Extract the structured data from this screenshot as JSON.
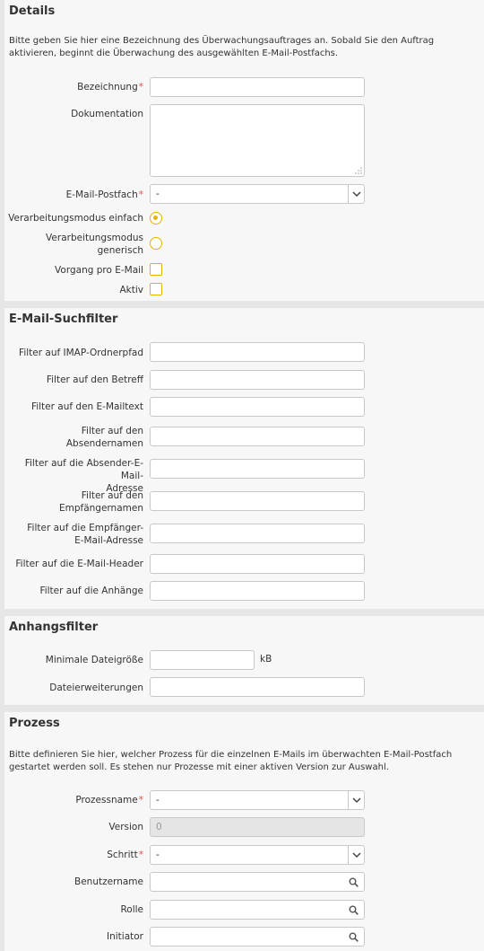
{
  "details": {
    "title": "Details",
    "description": "Bitte geben Sie hier eine Bezeichnung des Überwachungsauftrages an. Sobald Sie den Auftrag aktivieren, beginnt die Überwachung des ausgewählten E-Mail-Postfachs.",
    "bezeichnung_label": "Bezeichnung",
    "bezeichnung_value": "",
    "dokumentation_label": "Dokumentation",
    "dokumentation_value": "",
    "postfach_label": "E-Mail-Postfach",
    "postfach_value": "-",
    "mode_simple_label": "Verarbeitungsmodus einfach",
    "mode_simple_checked": true,
    "mode_generic_label_1": "Verarbeitungsmodus",
    "mode_generic_label_2": "generisch",
    "mode_generic_checked": false,
    "vorgang_label": "Vorgang pro E-Mail",
    "vorgang_checked": false,
    "aktiv_label": "Aktiv",
    "aktiv_checked": false
  },
  "suchfilter": {
    "title": "E-Mail-Suchfilter",
    "imap_label": "Filter auf IMAP-Ordnerpfad",
    "betreff_label": "Filter auf den Betreff",
    "mailtext_label": "Filter auf den E-Mailtext",
    "absendernamen_label_1": "Filter auf den",
    "absendernamen_label_2": "Absendernamen",
    "absenderadresse_label_1": "Filter auf die Absender-E-Mail-",
    "absenderadresse_label_2": "Adresse",
    "empfaengernamen_label_1": "Filter auf den",
    "empfaengernamen_label_2": "Empfängernamen",
    "empfaengeradresse_label_1": "Filter auf die Empfänger-",
    "empfaengeradresse_label_2": "E-Mail-Adresse",
    "header_label": "Filter auf die E-Mail-Header",
    "anhaenge_label": "Filter auf die Anhänge"
  },
  "anhangsfilter": {
    "title": "Anhangsfilter",
    "min_size_label": "Minimale Dateigröße",
    "min_size_unit": "kB",
    "extensions_label": "Dateierweiterungen"
  },
  "prozess": {
    "title": "Prozess",
    "description": "Bitte definieren Sie hier, welcher Prozess für die einzelnen E-Mails im überwachten E-Mail-Postfach gestartet werden soll. Es stehen nur Prozesse mit einer aktiven Version zur Auswahl.",
    "prozessname_label": "Prozessname",
    "prozessname_value": "-",
    "version_label": "Version",
    "version_value": "0",
    "schritt_label": "Schritt",
    "schritt_value": "-",
    "benutzername_label": "Benutzername",
    "rolle_label": "Rolle",
    "initiator_label": "Initiator"
  },
  "required_marker": "*",
  "colors": {
    "accent": "#e3b400",
    "required": "#d9534f",
    "panel": "#f7f7f7",
    "background": "#e6e6e6"
  }
}
